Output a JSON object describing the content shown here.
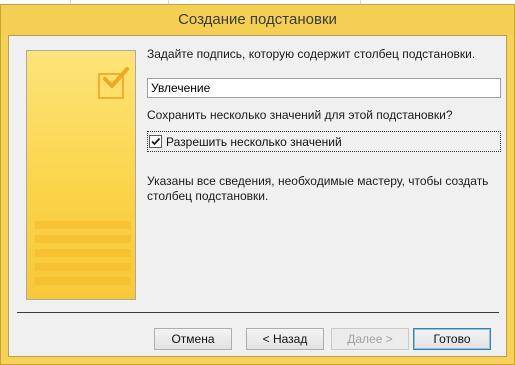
{
  "window": {
    "title": "Создание подстановки"
  },
  "form": {
    "caption_prompt": "Задайте подпись, которую содержит столбец подстановки.",
    "caption_value": "Увлечение",
    "multi_question": "Сохранить несколько значений для этой подстановки?",
    "multi_checkbox_label": "Разрешить несколько значений",
    "multi_checked": true,
    "summary": "Указаны все сведения, необходимые мастеру, чтобы создать столбец подстановки."
  },
  "buttons": {
    "cancel": "Отмена",
    "back": "< Назад",
    "next": "Далее >",
    "finish": "Готово"
  },
  "colors": {
    "title_bar": "#f5cf53",
    "dialog_bg": "#f0f0f0",
    "illustration": "#fbd44a",
    "default_button_border": "#3c7fb1"
  },
  "icons": [
    "wizard-checkbox-illustration",
    "checkmark-icon"
  ]
}
